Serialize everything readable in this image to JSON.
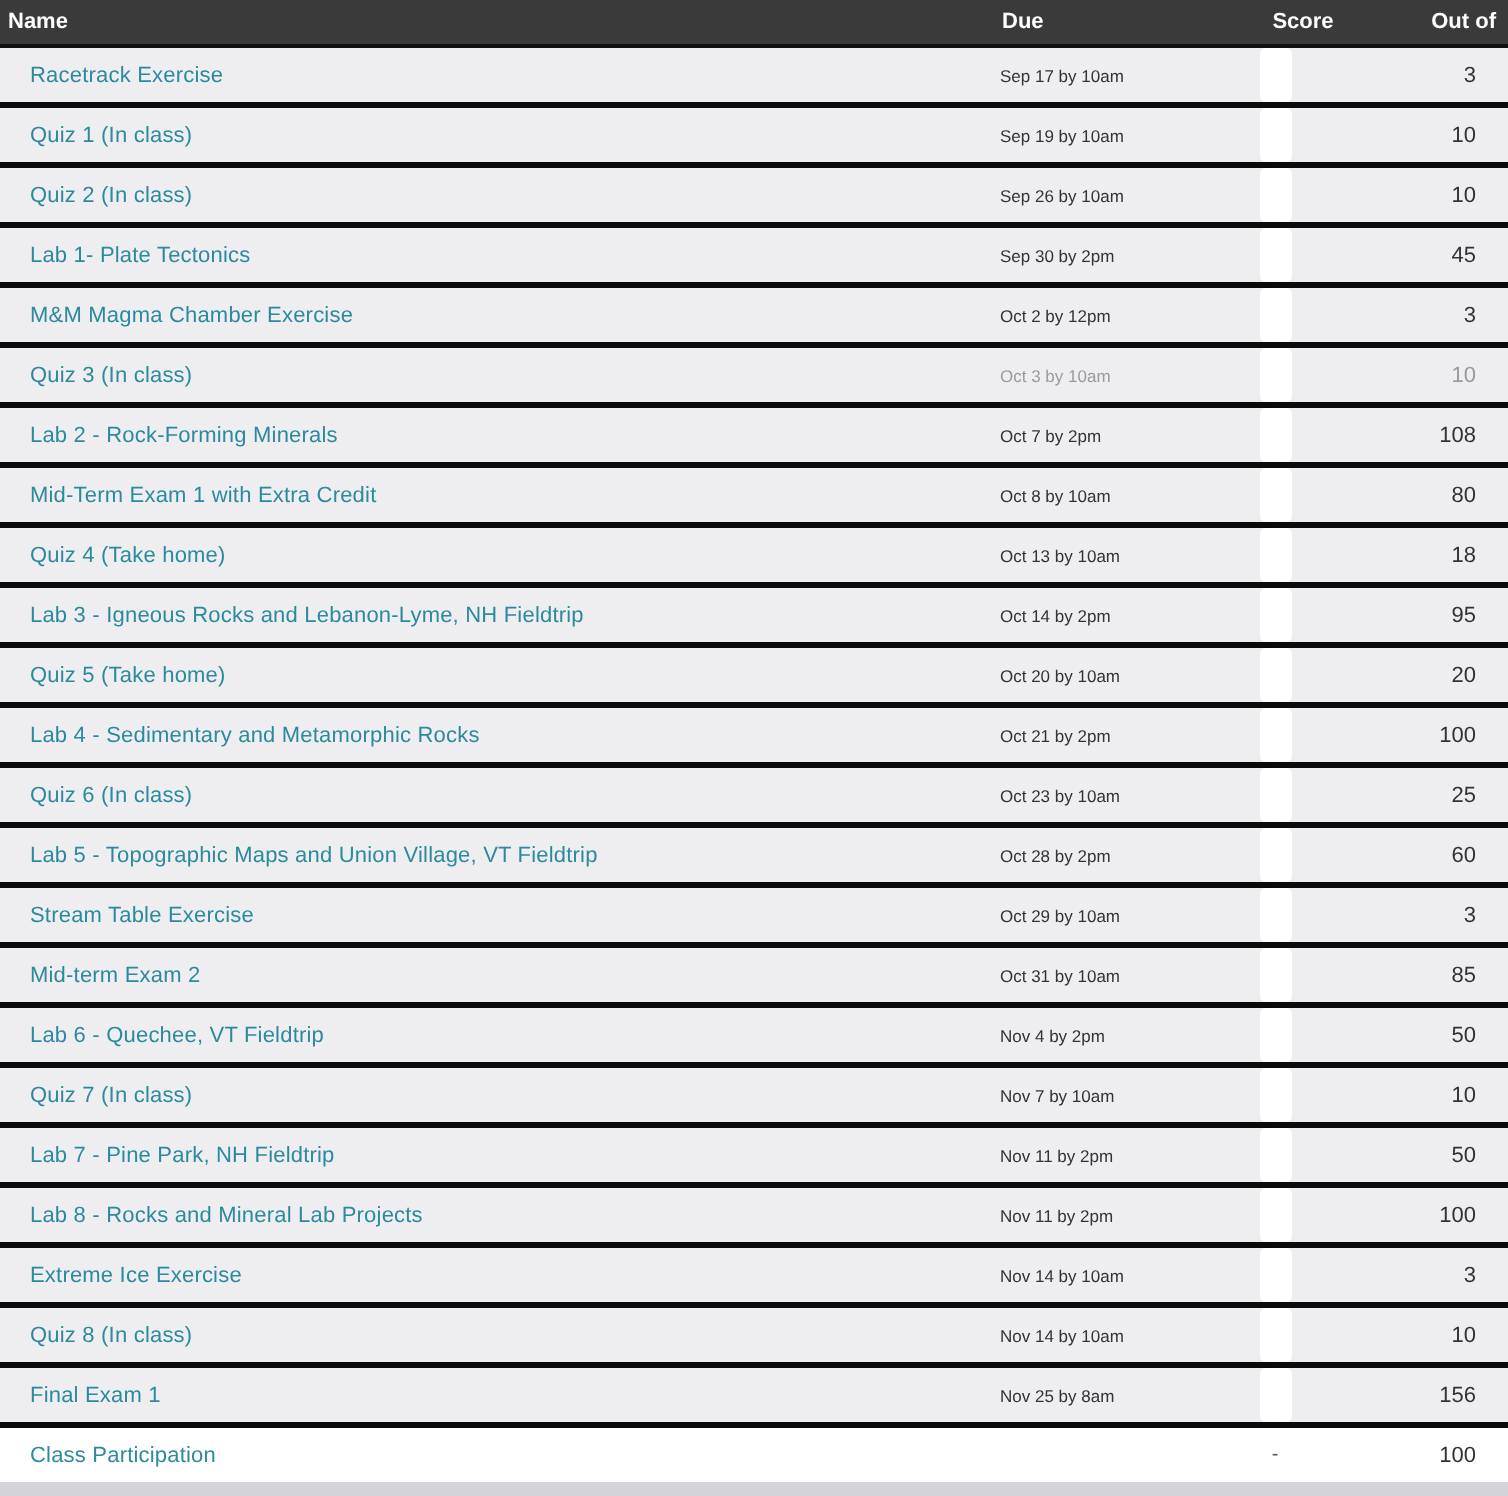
{
  "table": {
    "columns": [
      "Name",
      "Due",
      "Score",
      "Out of"
    ],
    "rows": [
      {
        "name": "Racetrack Exercise",
        "due": "Sep 17 by 10am",
        "score_hidden": true,
        "out_of": "3",
        "muted": false
      },
      {
        "name": "Quiz 1 (In class)",
        "due": "Sep 19 by 10am",
        "score_hidden": true,
        "out_of": "10",
        "muted": false
      },
      {
        "name": "Quiz 2 (In class)",
        "due": "Sep 26 by 10am",
        "score_hidden": true,
        "out_of": "10",
        "muted": false
      },
      {
        "name": "Lab 1- Plate Tectonics",
        "due": "Sep 30 by 2pm",
        "score_hidden": true,
        "out_of": "45",
        "muted": false
      },
      {
        "name": "M&M Magma Chamber Exercise",
        "due": "Oct 2 by 12pm",
        "score_hidden": true,
        "out_of": "3",
        "muted": false
      },
      {
        "name": "Quiz 3 (In class)",
        "due": "Oct 3 by 10am",
        "score_hidden": true,
        "out_of": "10",
        "muted": true
      },
      {
        "name": "Lab 2 - Rock-Forming Minerals",
        "due": "Oct 7 by 2pm",
        "score_hidden": true,
        "out_of": "108",
        "muted": false
      },
      {
        "name": "Mid-Term Exam 1 with Extra Credit",
        "due": "Oct 8 by 10am",
        "score_hidden": true,
        "out_of": "80",
        "muted": false
      },
      {
        "name": "Quiz 4 (Take home)",
        "due": "Oct 13 by 10am",
        "score_hidden": true,
        "out_of": "18",
        "muted": false
      },
      {
        "name": "Lab 3 - Igneous Rocks and Lebanon-Lyme, NH Fieldtrip",
        "due": "Oct 14 by 2pm",
        "score_hidden": true,
        "out_of": "95",
        "muted": false
      },
      {
        "name": "Quiz 5 (Take home)",
        "due": "Oct 20 by 10am",
        "score_hidden": true,
        "out_of": "20",
        "muted": false
      },
      {
        "name": "Lab 4 - Sedimentary and Metamorphic Rocks",
        "due": "Oct 21 by 2pm",
        "score_hidden": true,
        "out_of": "100",
        "muted": false
      },
      {
        "name": "Quiz 6 (In class)",
        "due": "Oct 23 by 10am",
        "score_hidden": true,
        "out_of": "25",
        "muted": false
      },
      {
        "name": "Lab 5 - Topographic Maps and Union Village, VT Fieldtrip",
        "due": "Oct 28 by 2pm",
        "score_hidden": true,
        "out_of": "60",
        "muted": false
      },
      {
        "name": "Stream Table Exercise",
        "due": "Oct 29 by 10am",
        "score_hidden": true,
        "out_of": "3",
        "muted": false
      },
      {
        "name": "Mid-term Exam 2",
        "due": "Oct 31 by 10am",
        "score_hidden": true,
        "out_of": "85",
        "muted": false
      },
      {
        "name": "Lab 6 - Quechee, VT Fieldtrip",
        "due": "Nov 4 by 2pm",
        "score_hidden": true,
        "out_of": "50",
        "muted": false
      },
      {
        "name": "Quiz 7 (In class)",
        "due": "Nov 7 by 10am",
        "score_hidden": true,
        "out_of": "10",
        "muted": false
      },
      {
        "name": "Lab 7 - Pine Park, NH Fieldtrip",
        "due": "Nov 11 by 2pm",
        "score_hidden": true,
        "out_of": "50",
        "muted": false
      },
      {
        "name": "Lab 8 - Rocks and Mineral Lab Projects",
        "due": "Nov 11 by 2pm",
        "score_hidden": true,
        "out_of": "100",
        "muted": false
      },
      {
        "name": "Extreme Ice Exercise",
        "due": "Nov 14 by 10am",
        "score_hidden": true,
        "out_of": "3",
        "muted": false
      },
      {
        "name": "Quiz 8 (In class)",
        "due": "Nov 14 by 10am",
        "score_hidden": true,
        "out_of": "10",
        "muted": false
      },
      {
        "name": "Final Exam 1",
        "due": "Nov 25 by 8am",
        "score_hidden": true,
        "out_of": "156",
        "muted": false
      },
      {
        "name": "Class Participation",
        "score": "-",
        "score_hidden": false,
        "out_of": "100",
        "muted": false,
        "plain": true
      }
    ]
  }
}
